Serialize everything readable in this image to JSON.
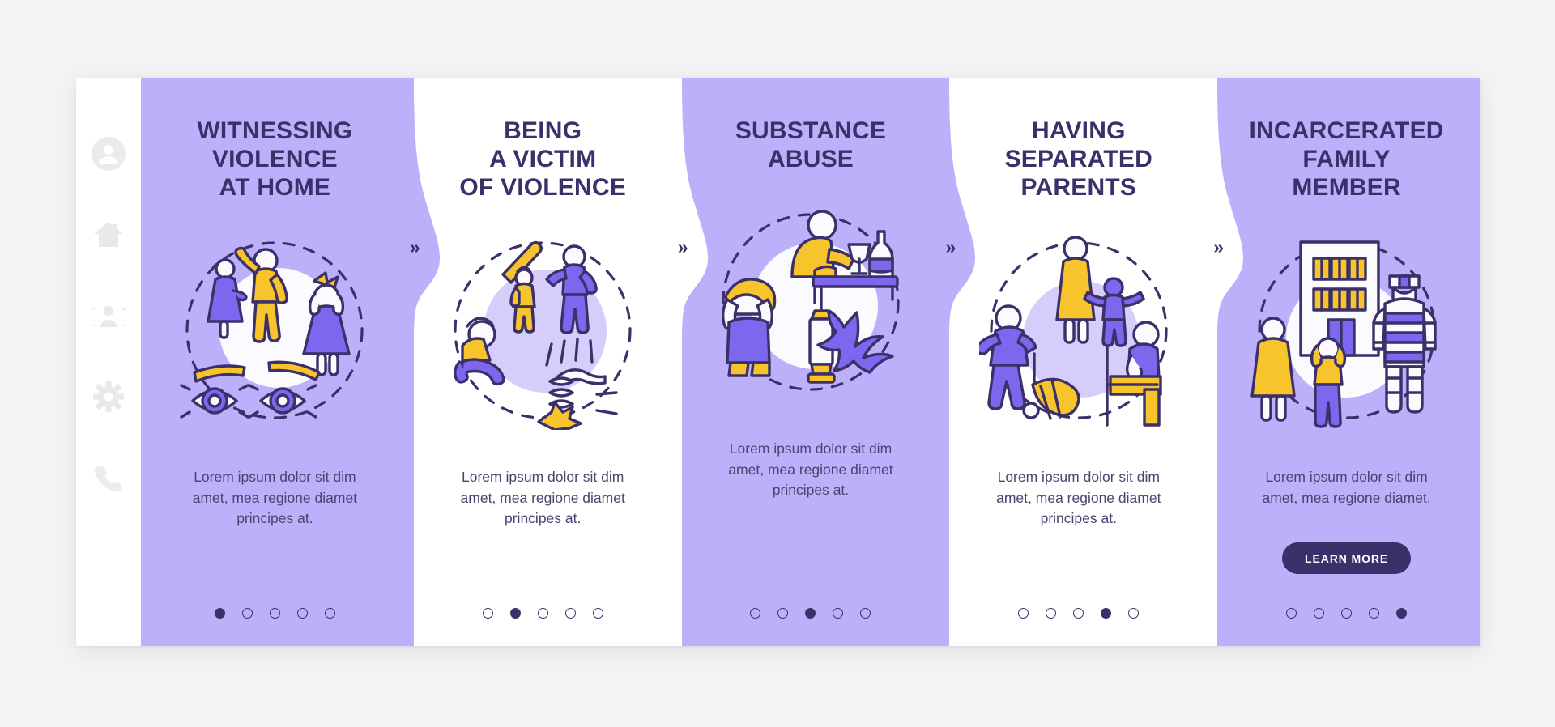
{
  "theme": {
    "page_background": "#f4f4f4",
    "card_background": "#ffffff",
    "panel_purple": "#bcb0fb",
    "panel_white": "#ffffff",
    "accent_dark": "#3b3069",
    "accent_yellow": "#f7c52b",
    "accent_violet": "#7b68ee",
    "sidebar_icon": "#e8e8e8",
    "circle_tint": "#d7cdfb"
  },
  "sidebar": {
    "items": [
      {
        "icon": "user-avatar-icon",
        "name": "sidebar-item-profile"
      },
      {
        "icon": "home-icon",
        "name": "sidebar-item-home"
      },
      {
        "icon": "group-people-icon",
        "name": "sidebar-item-community"
      },
      {
        "icon": "gear-icon",
        "name": "sidebar-item-settings"
      },
      {
        "icon": "phone-icon",
        "name": "sidebar-item-contact"
      }
    ]
  },
  "separator": {
    "glyph": "»",
    "name": "next-chevron"
  },
  "panels": [
    {
      "id": "witnessing-violence-at-home",
      "style": "purple",
      "title": "WITNESSING\nVIOLENCE\nAT HOME",
      "description": "Lorem ipsum dolor sit dim\namet, mea regione diamet\nprincipes at.",
      "illustration": "witnessing-violence-illustration",
      "dots": {
        "count": 5,
        "active": 0
      },
      "cta": null
    },
    {
      "id": "being-a-victim-of-violence",
      "style": "white",
      "title": "BEING\nA VICTIM\nOF VIOLENCE",
      "description": "Lorem ipsum dolor sit dim\namet, mea regione diamet\nprincipes at.",
      "illustration": "victim-of-violence-illustration",
      "dots": {
        "count": 5,
        "active": 1
      },
      "cta": null
    },
    {
      "id": "substance-abuse",
      "style": "purple",
      "title": "SUBSTANCE\nABUSE",
      "description": "Lorem ipsum dolor sit dim\namet, mea regione diamet\nprincipes at.",
      "illustration": "substance-abuse-illustration",
      "dots": {
        "count": 5,
        "active": 2
      },
      "cta": null
    },
    {
      "id": "having-separated-parents",
      "style": "white",
      "title": "HAVING\nSEPARATED\nPARENTS",
      "description": "Lorem ipsum dolor sit dim\namet, mea regione diamet\nprincipes at.",
      "illustration": "separated-parents-illustration",
      "dots": {
        "count": 5,
        "active": 3
      },
      "cta": null
    },
    {
      "id": "incarcerated-family-member",
      "style": "purple",
      "title": "INCARCERATED\nFAMILY\nMEMBER",
      "description": "Lorem ipsum dolor sit dim\namet, mea regione diamet.",
      "illustration": "incarcerated-family-illustration",
      "dots": {
        "count": 5,
        "active": 4
      },
      "cta": "LEARN MORE"
    }
  ]
}
